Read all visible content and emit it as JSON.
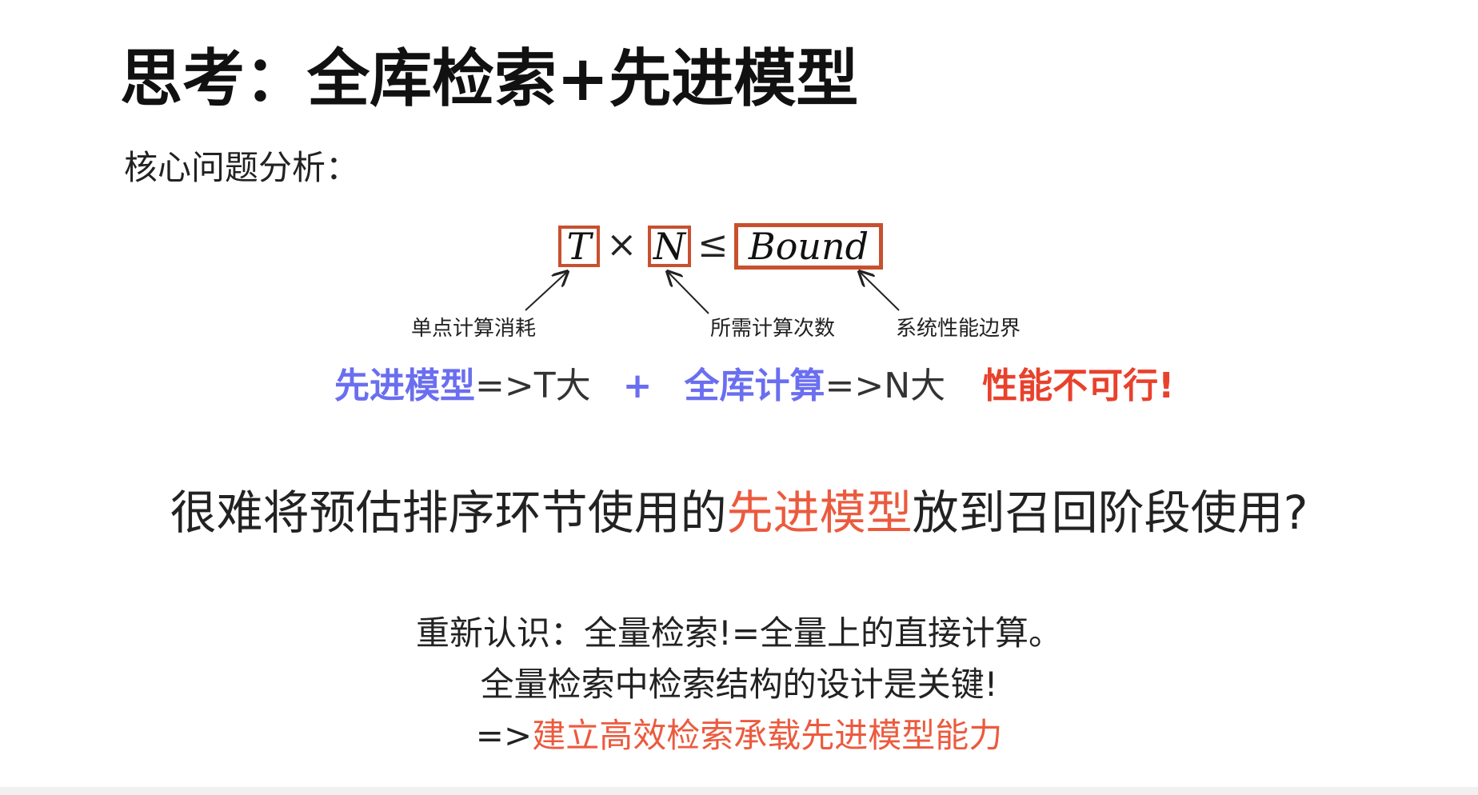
{
  "slide": {
    "title": "思考：全库检索+先进模型",
    "section_label": "核心问题分析："
  },
  "formula": {
    "term_t": "T",
    "times": "×",
    "term_n": "N",
    "leq": "≤",
    "term_bound": "Bound",
    "box_color": "#c8502e",
    "annotations": {
      "t_label": "单点计算消耗",
      "n_label": "所需计算次数",
      "bound_label": "系统性能边界"
    }
  },
  "analysis": {
    "part1_highlight": "先进模型",
    "part1_rest": "=>T大",
    "plus": "+",
    "part2_highlight": "全库计算",
    "part2_rest": "=>N大",
    "verdict": "性能不可行!",
    "highlight_color": "#6a6ef0",
    "verdict_color": "#e8412c"
  },
  "question": {
    "prefix": "很难将预估排序环节使用的",
    "highlight": "先进模型",
    "suffix": "放到召回阶段使用?"
  },
  "conclusion": {
    "line1": "重新认识：全量检索!=全量上的直接计算。",
    "line2": "全量检索中检索结构的设计是关键!",
    "line3_prefix": "=>",
    "line3_highlight": "建立高效检索承载先进模型能力",
    "highlight_color": "#ec5a3e"
  }
}
